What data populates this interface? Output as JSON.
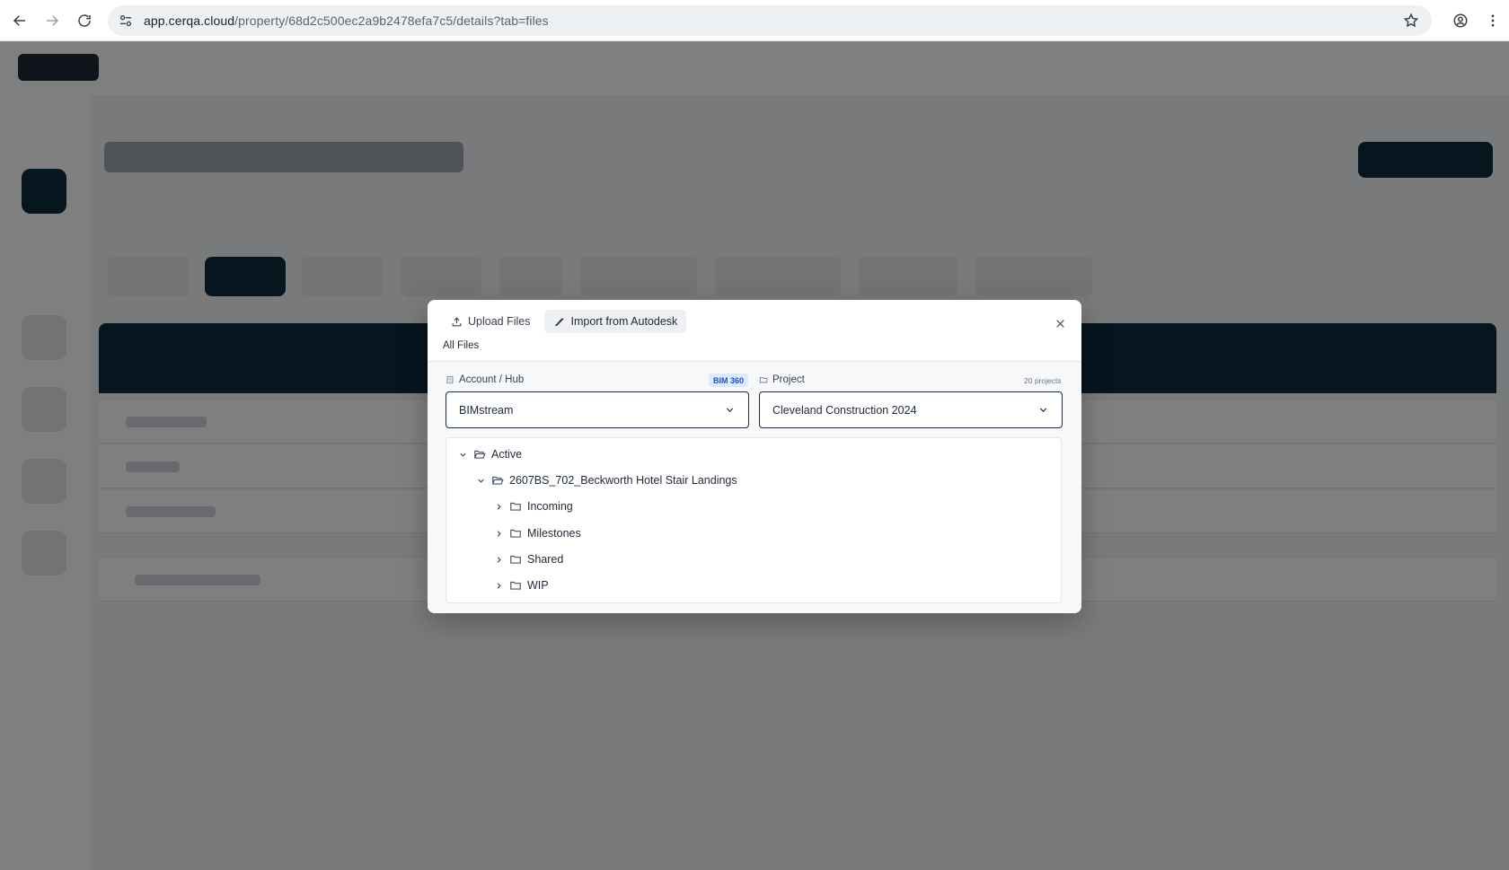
{
  "browser": {
    "url_host": "app.cerqa.cloud",
    "url_path": "/property/68d2c500ec2a9b2478efa7c5/details?tab=files"
  },
  "modal": {
    "tabs": [
      {
        "label": "Upload Files",
        "icon": "upload-icon",
        "active": false
      },
      {
        "label": "Import from Autodesk",
        "icon": "autodesk-icon",
        "active": true
      }
    ],
    "breadcrumb": "All Files",
    "account": {
      "label": "Account / Hub",
      "badge": "BIM 360",
      "value": "BIMstream"
    },
    "project": {
      "label": "Project",
      "count": "20 projects",
      "value": "Cleveland Construction 2024"
    },
    "tree": [
      {
        "label": "Active",
        "level": 0,
        "expanded": true
      },
      {
        "label": "2607BS_702_Beckworth Hotel Stair Landings",
        "level": 1,
        "expanded": true
      },
      {
        "label": "Incoming",
        "level": 2,
        "expanded": false
      },
      {
        "label": "Milestones",
        "level": 2,
        "expanded": false
      },
      {
        "label": "Shared",
        "level": 2,
        "expanded": false
      },
      {
        "label": "WIP",
        "level": 2,
        "expanded": false
      }
    ]
  }
}
